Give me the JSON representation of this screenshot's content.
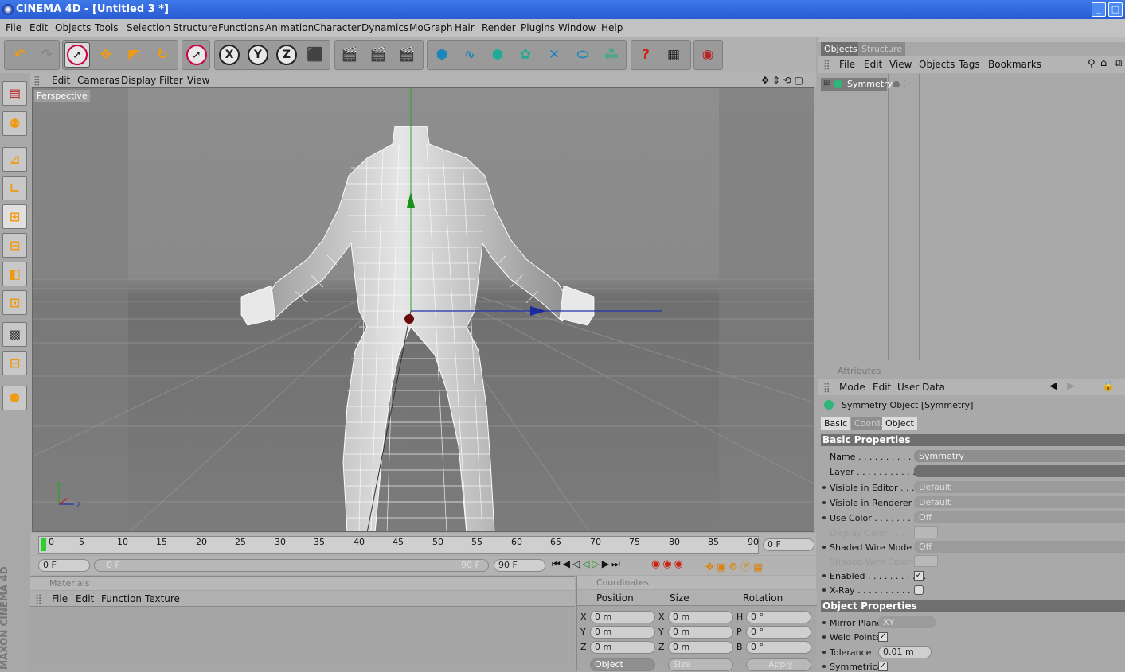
{
  "window": {
    "title": "CINEMA 4D - [Untitled 3 *]"
  },
  "menubar": [
    "File",
    "Edit",
    "Objects",
    "Tools",
    "Selection",
    "Structure",
    "Functions",
    "Animation",
    "Character",
    "Dynamics",
    "MoGraph",
    "Hair",
    "Render",
    "Plugins",
    "Window",
    "Help"
  ],
  "viewport": {
    "menu": [
      "Edit",
      "Cameras",
      "Display",
      "Filter",
      "View"
    ],
    "label": "Perspective"
  },
  "timeline": {
    "ticks": [
      "0",
      "5",
      "10",
      "15",
      "20",
      "25",
      "30",
      "35",
      "40",
      "45",
      "50",
      "55",
      "60",
      "65",
      "70",
      "75",
      "80",
      "85",
      "90"
    ],
    "current_frame": "0 F",
    "start_field": "0 F",
    "range_start": "0 F",
    "range_end": "90 F",
    "end_field": "90 F"
  },
  "materials": {
    "title": "Materials",
    "menu": [
      "File",
      "Edit",
      "Function",
      "Texture"
    ]
  },
  "coordinates": {
    "title": "Coordinates",
    "headers": [
      "Position",
      "Size",
      "Rotation"
    ],
    "rows": [
      {
        "axis": "X",
        "pos": "0 m",
        "size_axis": "X",
        "size": "0 m",
        "rot_axis": "H",
        "rot": "0 °"
      },
      {
        "axis": "Y",
        "pos": "0 m",
        "size_axis": "Y",
        "size": "0 m",
        "rot_axis": "P",
        "rot": "0 °"
      },
      {
        "axis": "Z",
        "pos": "0 m",
        "size_axis": "Z",
        "size": "0 m",
        "rot_axis": "B",
        "rot": "0 °"
      }
    ],
    "mode_select": "Object",
    "size_select": "Size",
    "apply_label": "Apply"
  },
  "objects_panel": {
    "tabs": [
      "Objects",
      "Structure"
    ],
    "menu": [
      "File",
      "Edit",
      "View",
      "Objects",
      "Tags",
      "Bookmarks"
    ],
    "items": [
      {
        "name": "Symmetry"
      }
    ]
  },
  "attributes_panel": {
    "title": "Attributes",
    "menu": [
      "Mode",
      "Edit",
      "User Data"
    ],
    "object_label": "Symmetry Object [Symmetry]",
    "tabs": [
      "Basic",
      "Coord.",
      "Object"
    ],
    "basic_header": "Basic Properties",
    "basic": [
      {
        "label": "Name . . . . . . . . . . . .",
        "value": "Symmetry"
      },
      {
        "label": "Layer . . . . . . . . . . . .",
        "value": ""
      },
      {
        "label": "Visible in Editor . . . . .",
        "value": "Default"
      },
      {
        "label": "Visible in Renderer . . .",
        "value": "Default"
      },
      {
        "label": "Use Color . . . . . . . . . .",
        "value": "Off"
      },
      {
        "label": "Display Color . . . . .",
        "value": ""
      },
      {
        "label": "Shaded Wire Mode",
        "value": "Off"
      },
      {
        "label": "Shaded Wire Color",
        "value": ""
      },
      {
        "label": "Enabled . . . . . . . . . . .",
        "value": "✓"
      },
      {
        "label": "X-Ray . . . . . . . . . . . .",
        "value": ""
      }
    ],
    "object_header": "Object Properties",
    "object": [
      {
        "label": "Mirror Plane",
        "value": "XY"
      },
      {
        "label": "Weld Points",
        "value": "✓"
      },
      {
        "label": "Tolerance",
        "value": "0.01 m"
      },
      {
        "label": "Symmetrical",
        "value": "✓"
      }
    ]
  },
  "brand": "MAXON CINEMA 4D"
}
